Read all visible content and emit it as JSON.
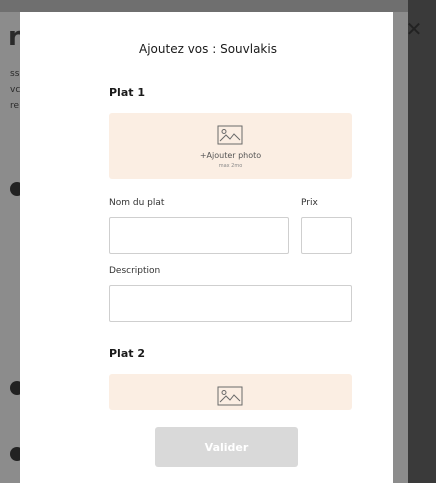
{
  "background": {
    "char": "r",
    "lines": [
      "ss",
      "vc",
      "re"
    ]
  },
  "modal": {
    "title": "Ajoutez vos : Souvlakis",
    "close_glyph": "✕",
    "plats": [
      {
        "label": "Plat 1",
        "photo_text": "+Ajouter photo",
        "photo_limit": "max 2mo"
      },
      {
        "label": "Plat 2"
      }
    ],
    "fields": {
      "name_label": "Nom du plat",
      "name_value": "",
      "price_label": "Prix",
      "price_value": "",
      "description_label": "Description",
      "description_value": ""
    },
    "submit_label": "Valider"
  },
  "colors": {
    "overlay": "#8c8c8c",
    "photo_bg": "#fbeee3",
    "button_disabled": "#d9d9d9"
  }
}
